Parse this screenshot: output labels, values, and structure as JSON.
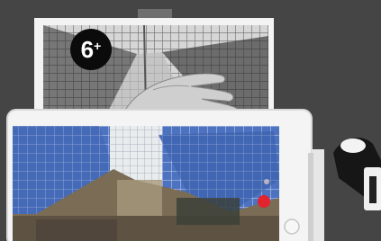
{
  "image": {
    "description_items": [
      {
        "name": "printed-photo"
      },
      {
        "name": "hand"
      },
      {
        "name": "tablet"
      },
      {
        "name": "camera-view"
      },
      {
        "name": "record-button"
      },
      {
        "name": "home-button"
      },
      {
        "name": "stapler"
      }
    ]
  },
  "badge": {
    "number": "6",
    "plus": "+"
  },
  "colors": {
    "table": "#4a4a4a",
    "paper": "#f2f2f2",
    "tablet_frame": "#f4f4f4",
    "sky": "#3f63b0",
    "record_button": "#e3232e",
    "badge_background": "#0b0b0b"
  }
}
